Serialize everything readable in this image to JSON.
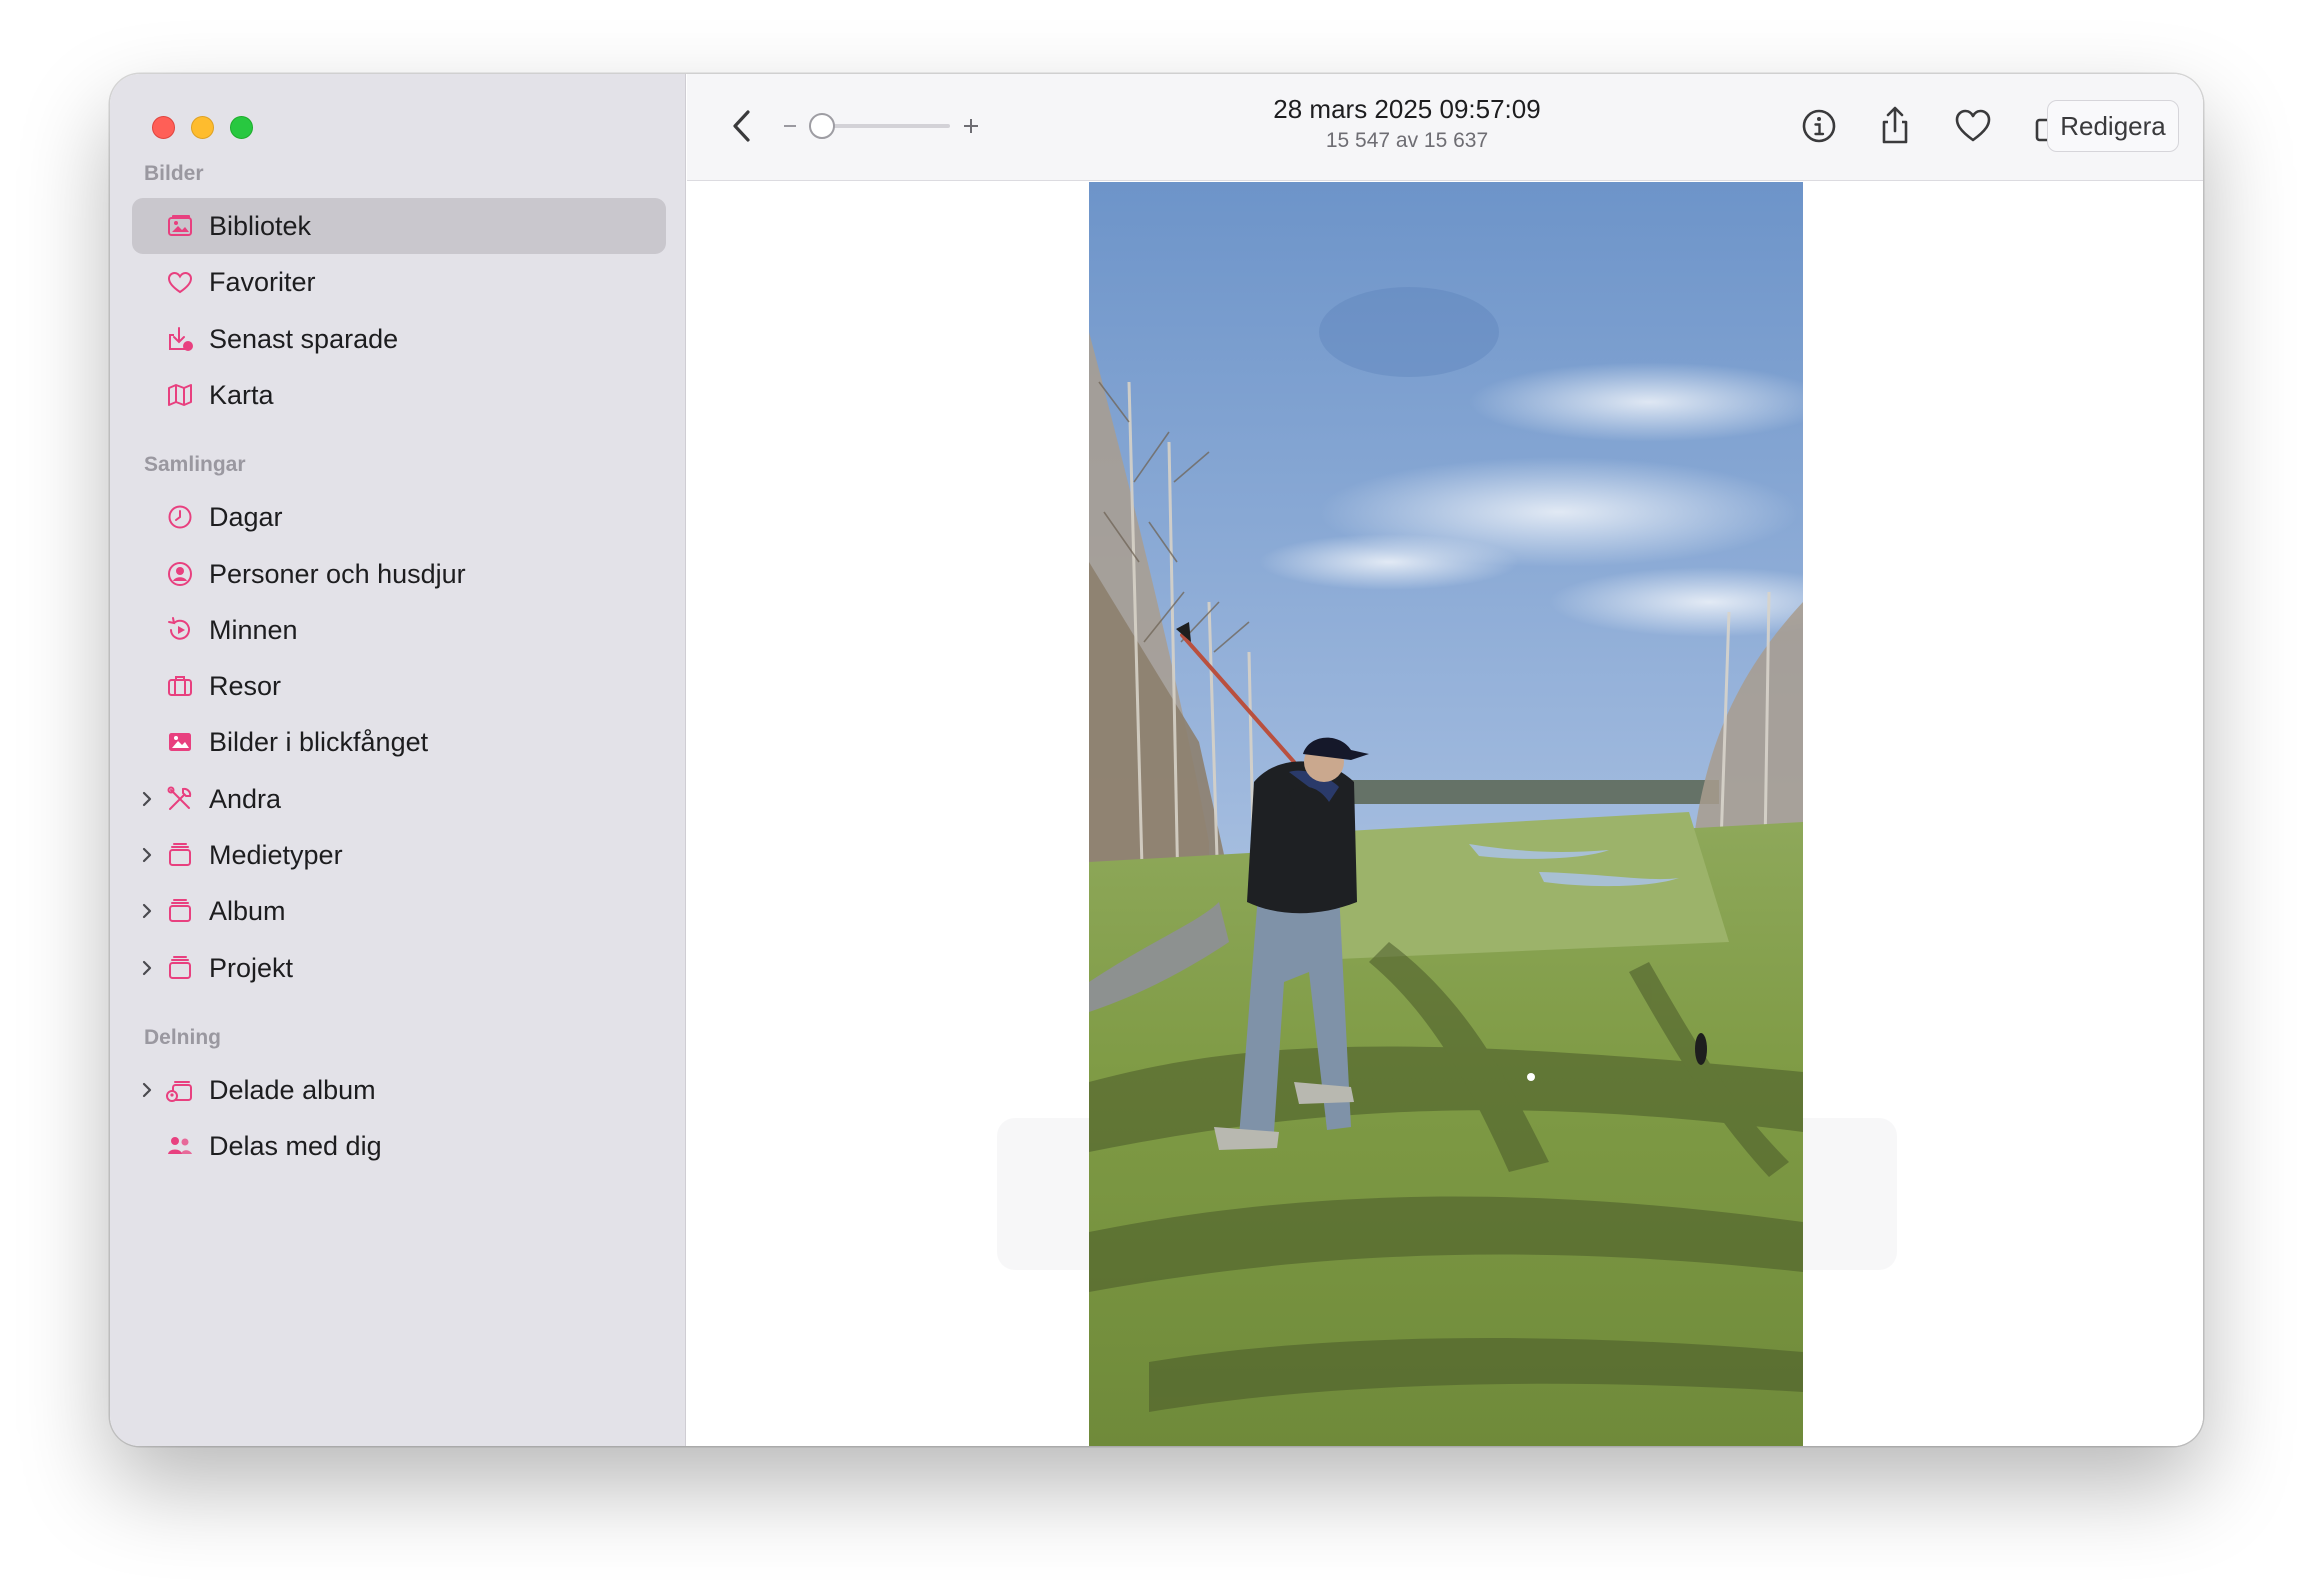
{
  "window": {
    "traffic_lights": [
      "close",
      "minimize",
      "zoom"
    ]
  },
  "sidebar": {
    "sections": [
      {
        "title": "Bilder",
        "items": [
          {
            "label": "Bibliotek",
            "icon": "photo-library-icon",
            "selected": true,
            "expandable": false
          },
          {
            "label": "Favoriter",
            "icon": "heart-icon",
            "selected": false,
            "expandable": false
          },
          {
            "label": "Senast sparade",
            "icon": "recently-saved-icon",
            "selected": false,
            "expandable": false
          },
          {
            "label": "Karta",
            "icon": "map-icon",
            "selected": false,
            "expandable": false
          }
        ]
      },
      {
        "title": "Samlingar",
        "items": [
          {
            "label": "Dagar",
            "icon": "clock-icon",
            "selected": false,
            "expandable": false
          },
          {
            "label": "Personer och husdjur",
            "icon": "person-circle-icon",
            "selected": false,
            "expandable": false
          },
          {
            "label": "Minnen",
            "icon": "memories-icon",
            "selected": false,
            "expandable": false
          },
          {
            "label": "Resor",
            "icon": "suitcase-icon",
            "selected": false,
            "expandable": false
          },
          {
            "label": "Bilder i blickfånget",
            "icon": "featured-photo-icon",
            "selected": false,
            "expandable": false
          },
          {
            "label": "Andra",
            "icon": "tools-icon",
            "selected": false,
            "expandable": true
          },
          {
            "label": "Medietyper",
            "icon": "stack-icon",
            "selected": false,
            "expandable": true
          },
          {
            "label": "Album",
            "icon": "stack-icon",
            "selected": false,
            "expandable": true
          },
          {
            "label": "Projekt",
            "icon": "stack-icon",
            "selected": false,
            "expandable": true
          }
        ]
      },
      {
        "title": "Delning",
        "items": [
          {
            "label": "Delade album",
            "icon": "shared-album-icon",
            "selected": false,
            "expandable": true
          },
          {
            "label": "Delas med dig",
            "icon": "shared-with-you-icon",
            "selected": false,
            "expandable": false
          }
        ]
      }
    ]
  },
  "toolbar": {
    "title": "28 mars 2025 09:57:09",
    "subtitle": "15 547 av 15 637",
    "zoom_level": 0,
    "edit_label": "Redigera",
    "icons": [
      "back-chevron-icon",
      "info-icon",
      "share-icon",
      "heart-icon",
      "rotate-icon",
      "magic-wand-icon"
    ]
  },
  "colors": {
    "accent": "#e8407f",
    "sidebar_bg": "#e3e2e8",
    "selection_bg": "#c9c7cd",
    "toolbar_bg": "#f6f6f8"
  }
}
